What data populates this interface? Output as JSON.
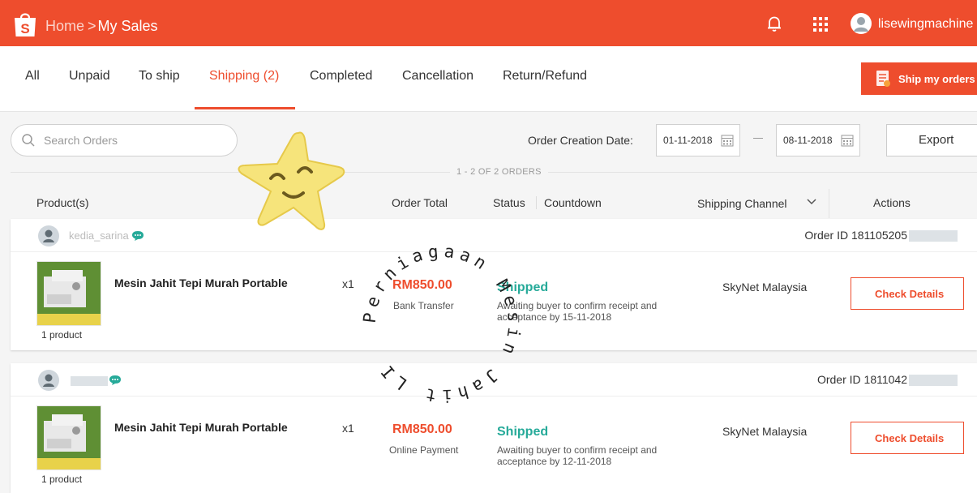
{
  "header": {
    "breadcrumb_home": "Home",
    "breadcrumb_sep": ">",
    "breadcrumb_current": "My Sales",
    "username": "lisewingmachine",
    "brand_color": "#ee4d2d"
  },
  "tabs": [
    {
      "label": "All"
    },
    {
      "label": "Unpaid"
    },
    {
      "label": "To ship"
    },
    {
      "label": "Shipping",
      "count": "(2)"
    },
    {
      "label": "Completed"
    },
    {
      "label": "Cancellation"
    },
    {
      "label": "Return/Refund"
    }
  ],
  "ship_button": "Ship my orders",
  "filters": {
    "search_placeholder": "Search Orders",
    "date_label": "Order Creation Date:",
    "date_from": "01-11-2018",
    "date_to": "08-11-2018",
    "export_label": "Export"
  },
  "orders_count": "1 - 2 OF 2 ORDERS",
  "columns": {
    "product": "Product(s)",
    "order_total": "Order Total",
    "status": "Status",
    "countdown": "Countdown",
    "shipping_channel": "Shipping Channel",
    "actions": "Actions"
  },
  "orders": [
    {
      "buyer": "kedia_sarina",
      "order_id": "Order ID 181105205",
      "product_name": "Mesin Jahit Tepi Murah Portable",
      "product_count": "1 product",
      "qty": "x1",
      "price": "RM850.00",
      "payment": "Bank Transfer",
      "status": "Shipped",
      "status_desc": "Awaiting buyer to confirm receipt and acceptance by 15-11-2018",
      "channel": "SkyNet Malaysia",
      "action": "Check Details"
    },
    {
      "buyer": "",
      "order_id": "Order ID 1811042",
      "product_name": "Mesin Jahit Tepi Murah Portable",
      "product_count": "1 product",
      "qty": "x1",
      "price": "RM850.00",
      "payment": "Online Payment",
      "status": "Shipped",
      "status_desc": "Awaiting buyer to confirm receipt and acceptance by 12-11-2018",
      "channel": "SkyNet Malaysia",
      "action": "Check Details"
    }
  ],
  "watermark": "Perniagaan Mesin Jahit LI",
  "icons": [
    "shopee-bag-icon",
    "bell-icon",
    "apps-grid-icon",
    "user-avatar-icon",
    "ship-orders-icon",
    "search-icon",
    "calendar-icon",
    "chevron-down-icon",
    "chat-icon",
    "star-sticker-icon"
  ],
  "status_color": "#26aa99"
}
